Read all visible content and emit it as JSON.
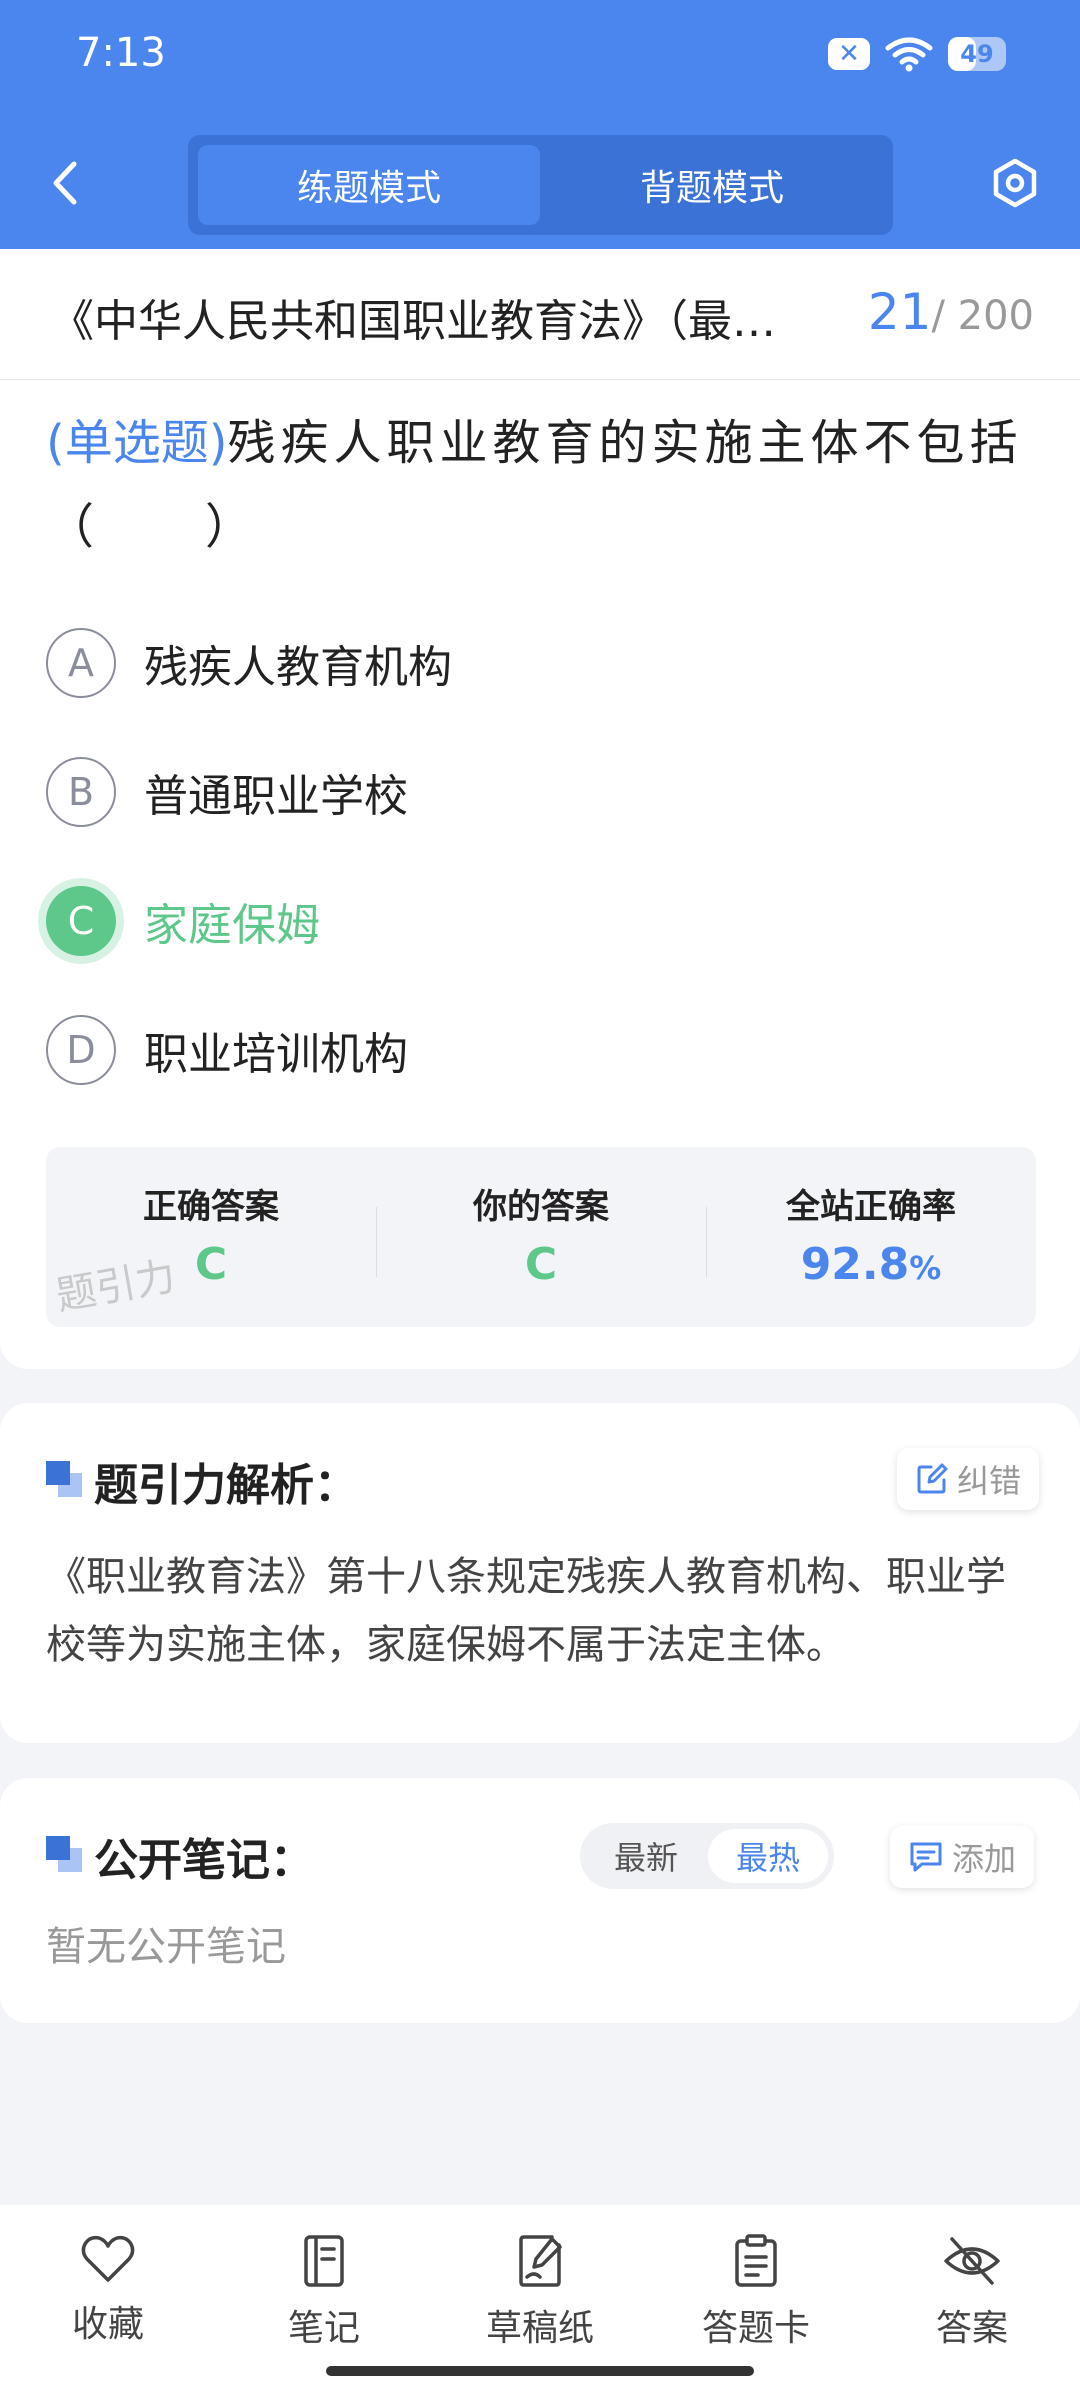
{
  "status_bar": {
    "time": "7:13",
    "battery": "49",
    "battery_level": 0.49
  },
  "header": {
    "tabs": [
      {
        "label": "练题模式",
        "active": true
      },
      {
        "label": "背题模式",
        "active": false
      }
    ]
  },
  "question_header": {
    "title": "《中华人民共和国职业教育法》（最…",
    "current": "21",
    "total": "/ 200"
  },
  "question": {
    "type": "(单选题)",
    "text": "残疾人职业教育的实施主体不包括",
    "blank": "（　　）",
    "options": [
      {
        "letter": "A",
        "text": "残疾人教育机构"
      },
      {
        "letter": "B",
        "text": "普通职业学校"
      },
      {
        "letter": "C",
        "text": "家庭保姆"
      },
      {
        "letter": "D",
        "text": "职业培训机构"
      }
    ]
  },
  "result": {
    "correct_label": "正确答案",
    "correct_value": "C",
    "yours_label": "你的答案",
    "yours_value": "C",
    "rate_label": "全站正确率",
    "rate_value": "92.8",
    "rate_unit": "%",
    "watermark": "题引力"
  },
  "analysis": {
    "title": "题引力解析：",
    "report_label": "纠错",
    "text": "《职业教育法》第十八条规定残疾人教育机构、职业学校等为实施主体，家庭保姆不属于法定主体。"
  },
  "notes": {
    "title": "公开笔记：",
    "sort_latest": "最新",
    "sort_hot": "最热",
    "add_label": "添加",
    "empty_text": "暂无公开笔记"
  },
  "bottom_nav": [
    {
      "label": "收藏",
      "icon": "heart-icon"
    },
    {
      "label": "笔记",
      "icon": "notebook-icon"
    },
    {
      "label": "草稿纸",
      "icon": "draft-icon"
    },
    {
      "label": "答题卡",
      "icon": "answer-sheet-icon"
    },
    {
      "label": "答案",
      "icon": "eye-off-icon"
    }
  ],
  "colors": {
    "primary": "#4A86EE",
    "correct": "#5DC88A",
    "background": "#F3F4F7"
  }
}
